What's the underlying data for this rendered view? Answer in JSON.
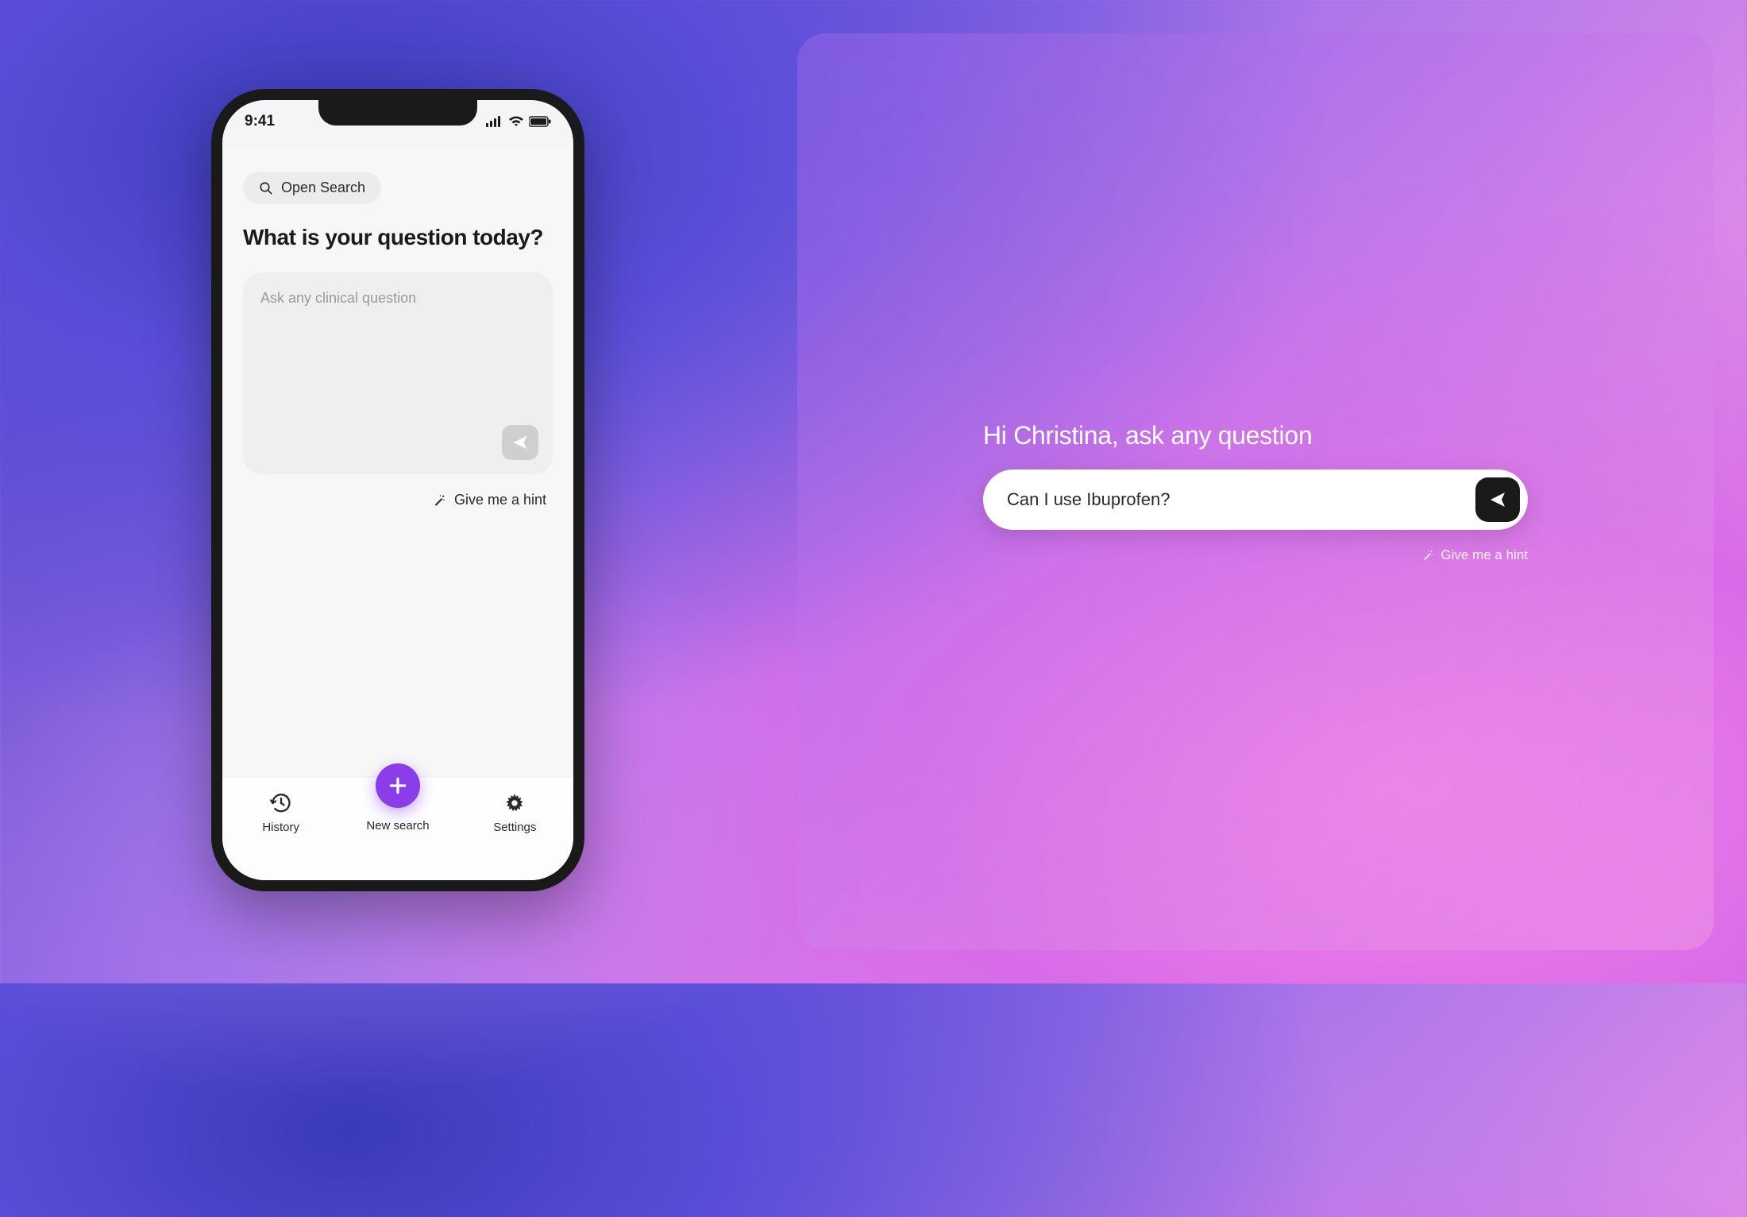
{
  "phone": {
    "statusTime": "9:41",
    "openSearchLabel": "Open Search",
    "heading": "What is your question today?",
    "inputPlaceholder": "Ask any clinical question",
    "hintLabel": "Give me a hint",
    "tabs": {
      "history": "History",
      "newSearch": "New search",
      "settings": "Settings"
    }
  },
  "desktop": {
    "greeting": "Hi Christina, ask any question",
    "inputValue": "Can I use Ibuprofen?",
    "hintLabel": "Give me a hint"
  }
}
